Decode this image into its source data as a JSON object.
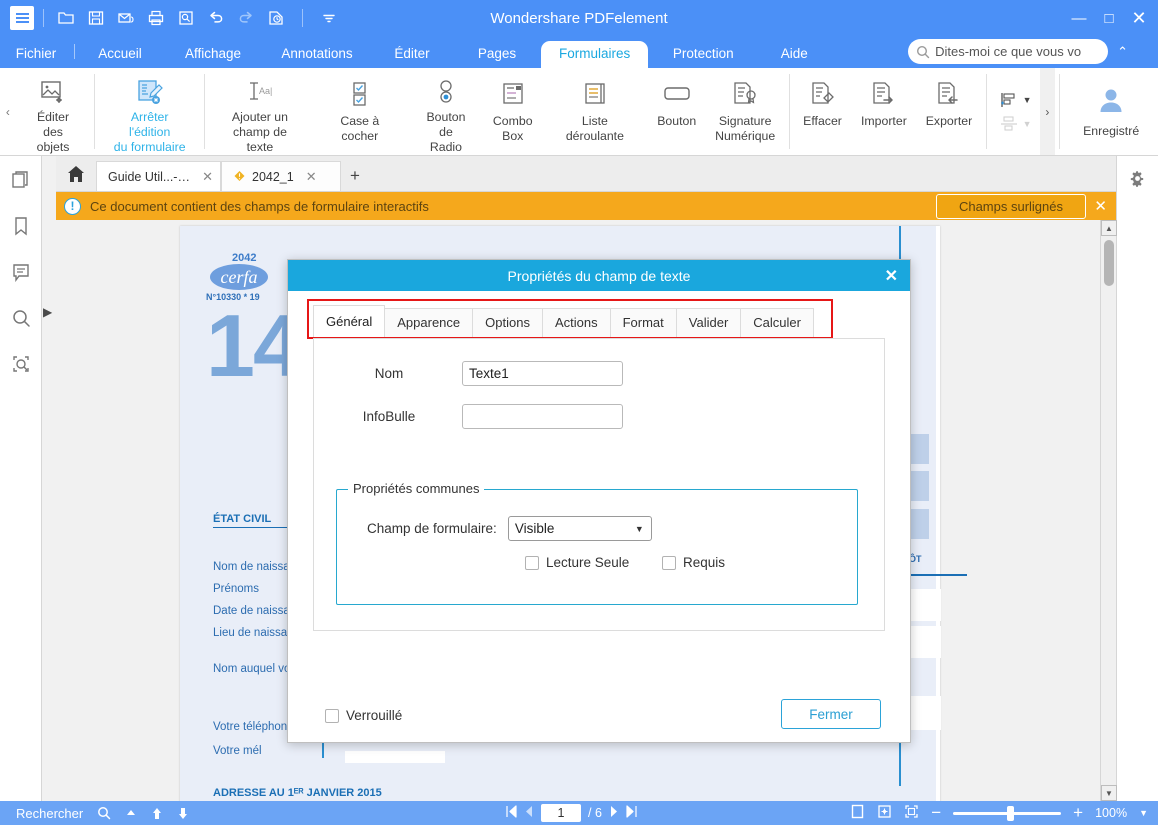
{
  "window": {
    "title": "Wondershare PDFelement",
    "minimize": "—",
    "maximize": "□",
    "close": "✕"
  },
  "quick_access": {
    "menu_icon": "hamburger-menu-icon",
    "items": [
      {
        "name": "open-icon",
        "label": "Ouvrir"
      },
      {
        "name": "save-icon",
        "label": "Enregistrer"
      },
      {
        "name": "email-icon",
        "label": "Email"
      },
      {
        "name": "print-icon",
        "label": "Imprimer"
      },
      {
        "name": "preview-icon",
        "label": "Aperçu"
      },
      {
        "name": "undo-icon",
        "label": "Annuler"
      },
      {
        "name": "redo-icon",
        "label": "Rétablir"
      },
      {
        "name": "recent-icon",
        "label": "Récent"
      },
      {
        "name": "more-icon",
        "label": "Plus"
      }
    ]
  },
  "ribbon_tabs": [
    {
      "label": "Fichier",
      "active": false
    },
    {
      "label": "Accueil",
      "active": false
    },
    {
      "label": "Affichage",
      "active": false
    },
    {
      "label": "Annotations",
      "active": false
    },
    {
      "label": "Éditer",
      "active": false
    },
    {
      "label": "Pages",
      "active": false
    },
    {
      "label": "Formulaires",
      "active": true
    },
    {
      "label": "Protection",
      "active": false
    },
    {
      "label": "Aide",
      "active": false
    }
  ],
  "search": {
    "placeholder": "Dites-moi ce que vous vo",
    "icon": "search-icon",
    "collapse_icon": "chevron-up-icon"
  },
  "ribbon": {
    "collapse_left": "‹",
    "collapse_right": "›",
    "items": [
      {
        "label_line1": "Éditer",
        "label_line2": "des objets",
        "icon": "edit-objects-icon",
        "accent": false
      },
      {
        "label_line1": "Arrêter l'édition",
        "label_line2": "du formulaire",
        "icon": "stop-form-edit-icon",
        "accent": true
      },
      {
        "label_line1": "Ajouter un",
        "label_line2": "champ de texte",
        "icon": "add-text-field-icon",
        "accent": false
      },
      {
        "label_line1": "Case à cocher",
        "label_line2": "",
        "icon": "checkbox-field-icon",
        "accent": false
      },
      {
        "label_line1": "Bouton de",
        "label_line2": "Radio",
        "icon": "radio-button-icon",
        "accent": false
      },
      {
        "label_line1": "Combo",
        "label_line2": "Box",
        "icon": "combo-box-icon",
        "accent": false
      },
      {
        "label_line1": "Liste déroulante",
        "label_line2": "",
        "icon": "list-box-icon",
        "accent": false
      },
      {
        "label_line1": "Bouton",
        "label_line2": "",
        "icon": "push-button-icon",
        "accent": false
      },
      {
        "label_line1": "Signature",
        "label_line2": "Numérique",
        "icon": "digital-signature-icon",
        "accent": false
      },
      {
        "label_line1": "Effacer",
        "label_line2": "",
        "icon": "clear-form-icon",
        "accent": false
      },
      {
        "label_line1": "Importer",
        "label_line2": "",
        "icon": "import-data-icon",
        "accent": false
      },
      {
        "label_line1": "Exporter",
        "label_line2": "",
        "icon": "export-data-icon",
        "accent": false
      }
    ],
    "align_tools": [
      {
        "icon": "align-left-icon",
        "enabled": true
      },
      {
        "icon": "distribute-icon",
        "enabled": false
      }
    ],
    "account": {
      "label": "Enregistré",
      "icon": "user-account-icon"
    }
  },
  "doc_tabs": {
    "home_icon": "home-icon",
    "tabs": [
      {
        "label": "Guide Util...--FR",
        "active": false,
        "has_warning": false
      },
      {
        "label": "2042_1",
        "active": true,
        "has_warning": true
      }
    ],
    "new_tab": "+",
    "close_glyph": "✕"
  },
  "left_rail": [
    {
      "name": "thumbnails-icon"
    },
    {
      "name": "bookmarks-icon"
    },
    {
      "name": "comments-icon"
    },
    {
      "name": "search-panel-icon"
    },
    {
      "name": "ocr-search-icon"
    }
  ],
  "right_panel": {
    "gear_icon": "gear-icon"
  },
  "notification": {
    "icon": "info-icon",
    "icon_glyph": "!",
    "message": "Ce document contient des champs de formulaire interactifs",
    "button": "Champs surlignés",
    "close": "✕"
  },
  "document": {
    "cerfa_number": "2042",
    "cerfa_logo": "cerfa",
    "cerfa_sub": "N°10330 * 19",
    "big_number": "14",
    "section_etat_civil": "ÉTAT CIVIL",
    "section_adresse": "ADRESSE AU 1ᴱᴿ JANVIER 2015",
    "fields": [
      "Nom de naissance",
      "Prénoms",
      "Date de naissance",
      "Lieu de naissance",
      "Nom auquel vos",
      "Votre téléphone",
      "Votre mél"
    ],
    "right_label": "ÔT"
  },
  "dialog": {
    "title": "Propriétés du champ de texte",
    "close": "✕",
    "tabs": [
      {
        "label": "Général",
        "active": true
      },
      {
        "label": "Apparence",
        "active": false
      },
      {
        "label": "Options",
        "active": false
      },
      {
        "label": "Actions",
        "active": false
      },
      {
        "label": "Format",
        "active": false
      },
      {
        "label": "Valider",
        "active": false
      },
      {
        "label": "Calculer",
        "active": false
      }
    ],
    "nom_label": "Nom",
    "nom_value": "Texte1",
    "infobulle_label": "InfoBulle",
    "infobulle_value": "",
    "group_legend": "Propriétés communes",
    "champ_label": "Champ de formulaire:",
    "champ_value": "Visible",
    "select_arrow": "▼",
    "checkbox_readonly": "Lecture Seule",
    "checkbox_required": "Requis",
    "checkbox_locked": "Verrouillé",
    "close_button": "Fermer"
  },
  "statusbar": {
    "search_label": "Rechercher",
    "search_icon": "search-icon",
    "prev_result_icon": "triangle-up-icon",
    "up_icon": "arrow-up-icon",
    "down_icon": "arrow-down-icon",
    "first_page_icon": "first-page-icon",
    "prev_page_icon": "prev-page-icon",
    "next_page_icon": "next-page-icon",
    "last_page_icon": "last-page-icon",
    "current_page": "1",
    "page_total": "/ 6",
    "view_single_icon": "single-page-icon",
    "view_fit_icon": "fit-page-icon",
    "view_full_icon": "fullscreen-icon",
    "zoom_out": "−",
    "zoom_in": "+",
    "zoom_level": "100%",
    "zoom_dropdown": "▼"
  },
  "colors": {
    "titlebar": "#4b90f7",
    "dialog_header": "#1aa7dd",
    "accent": "#2eb3e8",
    "notification": "#f5a81c",
    "highlight_red": "#e61717",
    "statusbar": "#6ba4f5"
  }
}
